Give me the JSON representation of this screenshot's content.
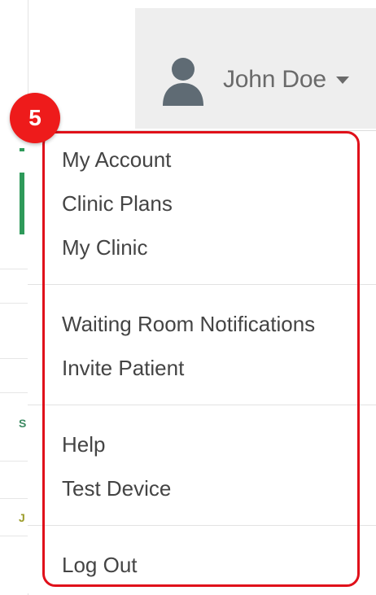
{
  "header": {
    "user_name": "John Doe",
    "avatar_icon": "user-avatar-icon",
    "caret_icon": "caret-down-icon"
  },
  "annotation": {
    "step_number": "5",
    "highlight_color": "#e0101a"
  },
  "menu": {
    "groups": [
      {
        "items": [
          "My Account",
          "Clinic Plans",
          "My Clinic"
        ]
      },
      {
        "items": [
          "Waiting Room Notifications",
          "Invite Patient"
        ]
      },
      {
        "items": [
          "Help",
          "Test Device"
        ]
      },
      {
        "items": [
          "Log Out"
        ]
      }
    ]
  },
  "background": {
    "peek_letters": [
      "S",
      "J"
    ]
  }
}
